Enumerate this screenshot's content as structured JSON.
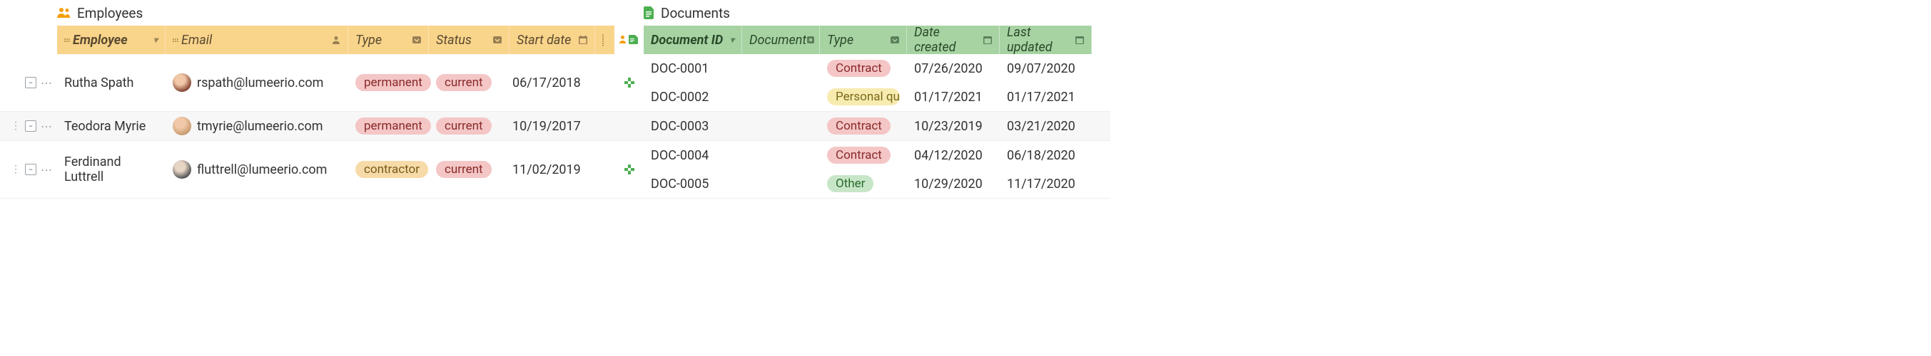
{
  "tables": {
    "employees": {
      "title": "Employees",
      "columns": {
        "employee": "Employee",
        "email": "Email",
        "type": "Type",
        "status": "Status",
        "start_date": "Start date"
      }
    },
    "documents": {
      "title": "Documents",
      "columns": {
        "doc_id": "Document ID",
        "document": "Document",
        "type": "Type",
        "date_created": "Date created",
        "last_updated": "Last updated"
      }
    }
  },
  "rows": [
    {
      "employee": {
        "name": "Rutha Spath",
        "email": "rspath@lumeerio.com",
        "type": "permanent",
        "status": "current",
        "start_date": "06/17/2018"
      },
      "documents": [
        {
          "id": "DOC-0001",
          "document": "",
          "type": "Contract",
          "date_created": "07/26/2020",
          "last_updated": "09/07/2020"
        },
        {
          "id": "DOC-0002",
          "document": "",
          "type": "Personal questionnaire",
          "date_created": "01/17/2021",
          "last_updated": "01/17/2021"
        }
      ]
    },
    {
      "employee": {
        "name": "Teodora Myrie",
        "email": "tmyrie@lumeerio.com",
        "type": "permanent",
        "status": "current",
        "start_date": "10/19/2017"
      },
      "documents": [
        {
          "id": "DOC-0003",
          "document": "",
          "type": "Contract",
          "date_created": "10/23/2019",
          "last_updated": "03/21/2020"
        }
      ]
    },
    {
      "employee": {
        "name": "Ferdinand Luttrell",
        "email": "fluttrell@lumeerio.com",
        "type": "contractor",
        "status": "current",
        "start_date": "11/02/2019"
      },
      "documents": [
        {
          "id": "DOC-0004",
          "document": "",
          "type": "Contract",
          "date_created": "04/12/2020",
          "last_updated": "06/18/2020"
        },
        {
          "id": "DOC-0005",
          "document": "",
          "type": "Other",
          "date_created": "10/29/2020",
          "last_updated": "11/17/2020"
        }
      ]
    }
  ],
  "type_styles": {
    "permanent": "perm",
    "contractor": "cont"
  },
  "status_styles": {
    "current": "curr"
  },
  "doc_type_styles": {
    "Contract": "contract",
    "Personal questionnaire": "pq",
    "Other": "other"
  },
  "doc_type_display": {
    "Personal questionnaire": "Personal ques"
  }
}
